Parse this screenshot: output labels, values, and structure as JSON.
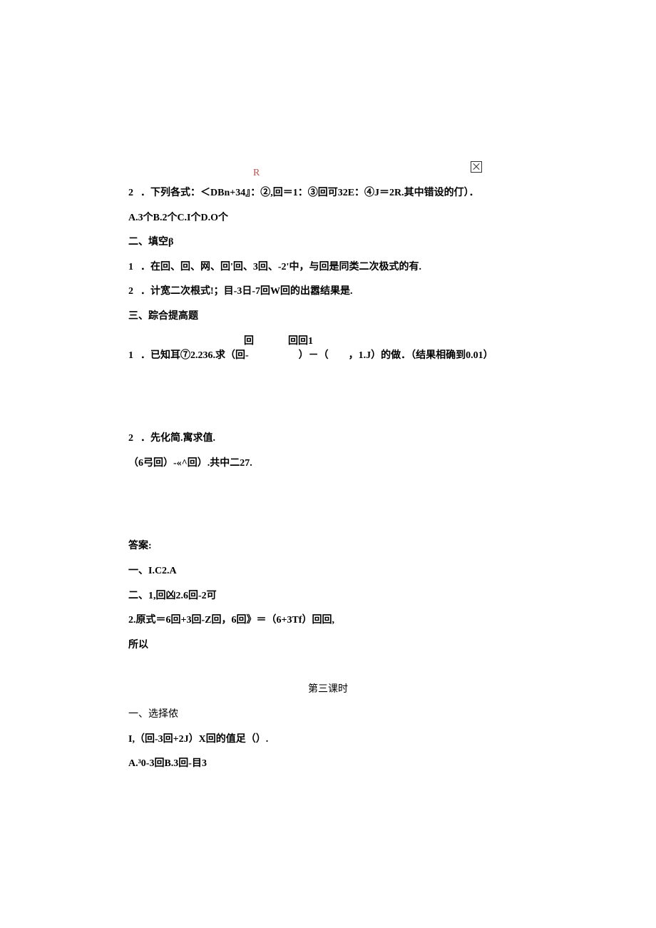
{
  "topmark": {
    "r": "R"
  },
  "q2_top": {
    "num": "2",
    "text": "．下列各式：＜DBn+34』：②,回＝1：③回可32E：④J＝2R.其中错设的仃）．"
  },
  "q2_choices": "A.3个B.2个C.I个D.O个",
  "sec2_title": "二、填空β",
  "fill1": {
    "num": "1",
    "text": "．在回、回、网、回'回、3回、-2'中，与回是同类二次极式的有."
  },
  "fill2": {
    "num": "2",
    "text": "．计宽二次根式!；目-3日-7回W回的出嚣结果是."
  },
  "sec3_title": "三、踪合提高题",
  "prob1_float": {
    "a": "回",
    "b": "回回1"
  },
  "prob1": {
    "num": "1",
    "text": "．已知耳⑦2.236.求（回-　　　　　）－（　　，1.J）的做．（结果相确到0.01）"
  },
  "prob2": {
    "num": "2",
    "text": "．先化简.寓求值."
  },
  "prob2_expr": "（6弓回）-«^回）.共中二27.",
  "ans_title": "答案:",
  "ans1": "一、I.C2.A",
  "ans2": "二、1,回凶2.6回-2可",
  "ans3": "2.原式＝6回+3回-Z回，6回》＝（6+3Tf）回回,",
  "ans4": "所以",
  "lesson3": "第三课时",
  "sec_choice": "一、选择侬",
  "cq1": "I,（回-3回+2J）X回的值足（）.",
  "cq1_choices": "A.³0-3回B.3回-目3"
}
